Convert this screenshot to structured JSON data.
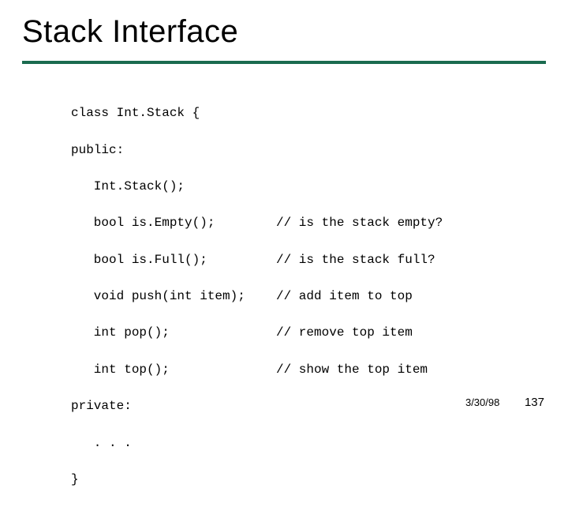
{
  "title": "Stack Interface",
  "code": {
    "l1": "class Int.Stack {",
    "l2": "public:",
    "l3": "   Int.Stack();",
    "l4": "   bool is.Empty();",
    "c4": "// is the stack empty?",
    "l5": "   bool is.Full();",
    "c5": "// is the stack full?",
    "l6": "   void push(int item);",
    "c6": "// add item to top",
    "l7": "   int pop();",
    "c7": "// remove top item",
    "l8": "   int top();",
    "c8": "// show the top item",
    "l9": "private:",
    "l10": "   . . .",
    "l11": "}"
  },
  "footer": {
    "date": "3/30/98",
    "page": "137"
  }
}
